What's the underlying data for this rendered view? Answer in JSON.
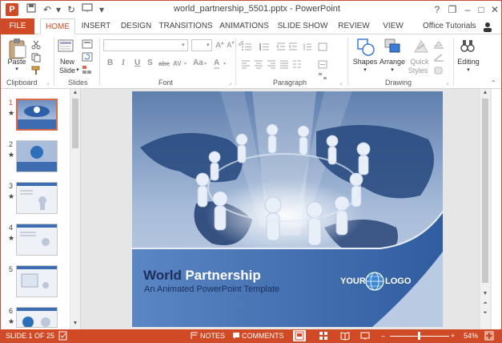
{
  "window": {
    "title": "world_partnership_5501.pptx - PowerPoint",
    "help": "?",
    "restore": "❐",
    "minimize": "–",
    "maximize": "□",
    "close": "✕"
  },
  "qat": {
    "save_icon": "save-icon",
    "undo_icon": "undo-icon",
    "redo_icon": "redo-icon",
    "start_icon": "start-from-beginning-icon",
    "customize_icon": "customize-qat-icon"
  },
  "ribbon_tabs": [
    "FILE",
    "HOME",
    "INSERT",
    "DESIGN",
    "TRANSITIONS",
    "ANIMATIONS",
    "SLIDE SHOW",
    "REVIEW",
    "VIEW"
  ],
  "account": "Office Tutorials",
  "ribbon": {
    "clipboard": {
      "label": "Clipboard",
      "paste": "Paste"
    },
    "slides": {
      "label": "Slides",
      "new_slide_line1": "New",
      "new_slide_line2": "Slide"
    },
    "font": {
      "label": "Font",
      "bold": "B",
      "italic": "I",
      "underline": "U",
      "shadow": "S",
      "strike": "abc",
      "spacing": "AV",
      "case": "Aa",
      "color": "A"
    },
    "paragraph": {
      "label": "Paragraph"
    },
    "drawing": {
      "label": "Drawing",
      "shapes": "Shapes",
      "arrange": "Arrange",
      "quick_styles_line1": "Quick",
      "quick_styles_line2": "Styles"
    },
    "editing": {
      "label": "Editing"
    }
  },
  "thumbnails": [
    {
      "num": "1",
      "star": "★"
    },
    {
      "num": "2",
      "star": "★"
    },
    {
      "num": "3",
      "star": "★"
    },
    {
      "num": "4",
      "star": "★"
    },
    {
      "num": "5",
      "star": ""
    },
    {
      "num": "6",
      "star": "★"
    }
  ],
  "slide": {
    "title_world": "World",
    "title_partnership": "Partnership",
    "subtitle": "An Animated PowerPoint Template",
    "logo_your": "YOUR",
    "logo_logo": "LOGO"
  },
  "statusbar": {
    "slide_info": "SLIDE 1 OF 25",
    "notes": "NOTES",
    "comments": "COMMENTS",
    "zoom": "54%",
    "zoom_level": 0.54,
    "minus": "–",
    "plus": "+"
  },
  "colors": {
    "accent": "#d04a26",
    "slide_title_dark": "#1c2f5e"
  }
}
